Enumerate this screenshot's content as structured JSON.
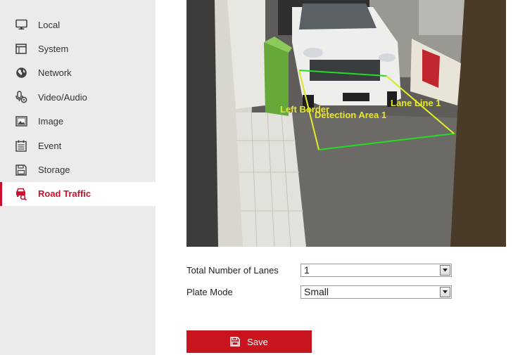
{
  "sidebar": {
    "items": [
      {
        "label": "Local",
        "icon": "monitor-icon",
        "active": false
      },
      {
        "label": "System",
        "icon": "window-icon",
        "active": false
      },
      {
        "label": "Network",
        "icon": "globe-icon",
        "active": false
      },
      {
        "label": "Video/Audio",
        "icon": "microphone-icon",
        "active": false
      },
      {
        "label": "Image",
        "icon": "image-icon",
        "active": false
      },
      {
        "label": "Event",
        "icon": "calendar-icon",
        "active": false
      },
      {
        "label": "Storage",
        "icon": "disk-icon",
        "active": false
      },
      {
        "label": "Road Traffic",
        "icon": "car-search-icon",
        "active": true
      }
    ]
  },
  "video": {
    "overlay_labels": {
      "left_border": "Left Border",
      "detection_area": "Detection Area 1",
      "lane_line": "Lane Line 1"
    }
  },
  "form": {
    "lanes_label": "Total Number of Lanes",
    "lanes_value": "1",
    "plate_mode_label": "Plate Mode",
    "plate_mode_value": "Small"
  },
  "save_button": {
    "label": "Save"
  },
  "colors": {
    "accent": "#c8102e",
    "detection_area": "#22dd22",
    "lane_line": "#e6e62a",
    "sidebar_bg": "#ebebeb"
  }
}
